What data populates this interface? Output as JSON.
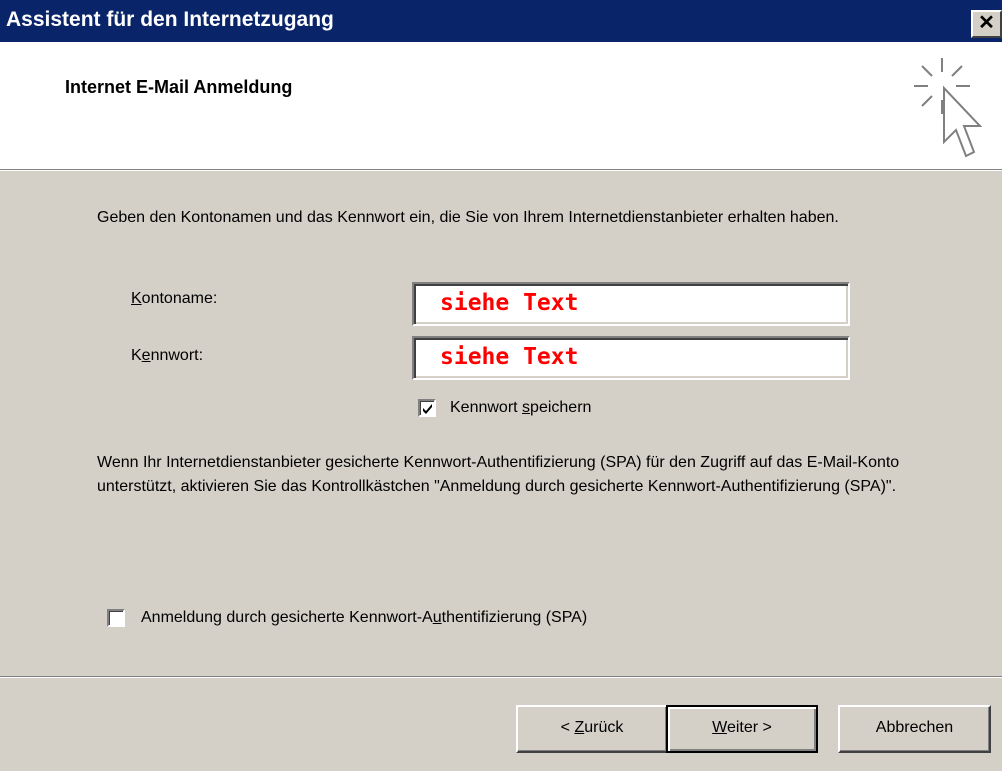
{
  "window": {
    "title": "Assistent für den Internetzugang",
    "close_label": "✕"
  },
  "header": {
    "title": "Internet E-Mail Anmeldung",
    "icon": "wizard-cursor-sparkle-icon"
  },
  "intro_text": "Geben den Kontonamen und das Kennwort ein, die Sie von Ihrem Internetdienstanbieter erhalten haben.",
  "fields": {
    "account_label_prefix": "K",
    "account_label_rest": "ontoname:",
    "account_value": "siehe Text",
    "password_label_prefix": "K",
    "password_label_underline": "e",
    "password_label_rest": "nnwort:",
    "password_value": "siehe Text",
    "value_color": "#ff0000"
  },
  "save_password": {
    "label_prefix": "Kennwort ",
    "label_underline": "s",
    "label_rest": "peichern",
    "checked": true
  },
  "spa_text": "Wenn Ihr Internetdienstanbieter gesicherte Kennwort-Authentifizierung (SPA) für den Zugriff auf das E-Mail-Konto unterstützt, aktivieren Sie das Kontrollkästchen \"Anmeldung durch gesicherte Kennwort-Authentifizierung (SPA)\".",
  "spa_checkbox": {
    "label_prefix": "Anmeldung durch gesicherte Kennwort-A",
    "label_underline": "u",
    "label_rest": "thentifizierung (SPA)",
    "checked": false
  },
  "buttons": {
    "back_prefix": "< ",
    "back_underline": "Z",
    "back_rest": "urück",
    "next_underline": "W",
    "next_rest": "eiter >",
    "cancel": "Abbrechen"
  },
  "colors": {
    "titlebar": "#0a246a",
    "face": "#d4d0c8",
    "header_bg": "#ffffff"
  }
}
